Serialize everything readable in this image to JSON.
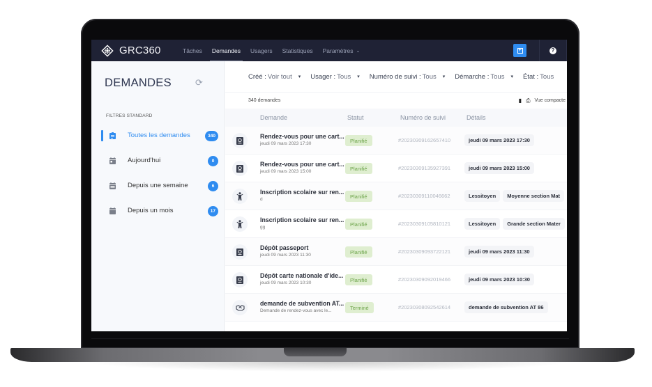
{
  "app": {
    "name": "GRC360",
    "nav": [
      {
        "label": "Tâches",
        "active": false
      },
      {
        "label": "Demandes",
        "active": true
      },
      {
        "label": "Usagers",
        "active": false
      },
      {
        "label": "Statistiques",
        "active": false
      },
      {
        "label": "Paramètres",
        "active": false,
        "dropdown": true
      }
    ],
    "add_icon": "plus-square-icon",
    "help_icon": "question-circle-icon",
    "help_glyph": "?",
    "add_glyph": "+",
    "caret_glyph": "⌄"
  },
  "sidebar": {
    "title": "DEMANDES",
    "refresh_glyph": "⟳",
    "section": "FILTRES STANDARD",
    "items": [
      {
        "label": "Toutes les demandes",
        "count": "340",
        "active": true,
        "icon": "clipboard-list-icon"
      },
      {
        "label": "Aujourd'hui",
        "count": "0",
        "active": false,
        "icon": "calendar-day-icon"
      },
      {
        "label": "Depuis une semaine",
        "count": "6",
        "active": false,
        "icon": "calendar-week-icon"
      },
      {
        "label": "Depuis un mois",
        "count": "17",
        "active": false,
        "icon": "calendar-icon"
      }
    ]
  },
  "filters": [
    {
      "label": "Créé :",
      "value": "Voir tout"
    },
    {
      "label": "Usager :",
      "value": "Tous"
    },
    {
      "label": "Numéro de suivi :",
      "value": "Tous"
    },
    {
      "label": "Démarche :",
      "value": "Tous"
    },
    {
      "label": "État :",
      "value": "Tous"
    }
  ],
  "filter_caret": "▾",
  "list": {
    "count_label": "340 demandes",
    "compact_label": "Vue compacte",
    "export_glyph": "▮",
    "print_glyph": "⎙",
    "columns": [
      "Demande",
      "Statut",
      "Numéro de suivi",
      "Détails"
    ],
    "status_colors": {
      "bg": "#dfeed0",
      "fg": "#6da44a"
    },
    "rows": [
      {
        "icon": "passport-icon",
        "title": "Rendez-vous pour une cart...",
        "subtitle": "jeudi 09 mars 2023 17:30",
        "status": "Planifié",
        "number": "#20230309162657410",
        "details": [
          "jeudi 09 mars 2023 17:30"
        ]
      },
      {
        "icon": "passport-icon",
        "title": "Rendez-vous pour une cart...",
        "subtitle": "jeudi 09 mars 2023 15:00",
        "status": "Planifié",
        "number": "#20230309135927391",
        "details": [
          "jeudi 09 mars 2023 15:00"
        ]
      },
      {
        "icon": "child-icon",
        "title": "Inscription scolaire sur ren...",
        "subtitle": "d",
        "status": "Planifié",
        "number": "#20230309110046662",
        "details": [
          "Lessitoyen",
          "Moyenne section Mat"
        ]
      },
      {
        "icon": "child-icon",
        "title": "Inscription scolaire sur ren...",
        "subtitle": "gg",
        "status": "Planifié",
        "number": "#20230309105810121",
        "details": [
          "Lessitoyen",
          "Grande section Mater"
        ]
      },
      {
        "icon": "passport-icon",
        "title": "Dépôt passeport",
        "subtitle": "jeudi 09 mars 2023 11:30",
        "status": "Planifié",
        "number": "#20230309093722121",
        "details": [
          "jeudi 09 mars 2023 11:30"
        ]
      },
      {
        "icon": "passport-icon",
        "title": "Dépôt carte nationale d'ide...",
        "subtitle": "jeudi 09 mars 2023 10:30",
        "status": "Planifié",
        "number": "#20230309092019466",
        "details": [
          "jeudi 09 mars 2023 10:30"
        ]
      },
      {
        "icon": "handshake-icon",
        "title": "demande de subvention AT...",
        "subtitle": "Demande de rendez-vous avec le...",
        "status": "Terminé",
        "number": "#20230308092542614",
        "details": [
          "demande de subvention AT 86"
        ]
      }
    ]
  }
}
